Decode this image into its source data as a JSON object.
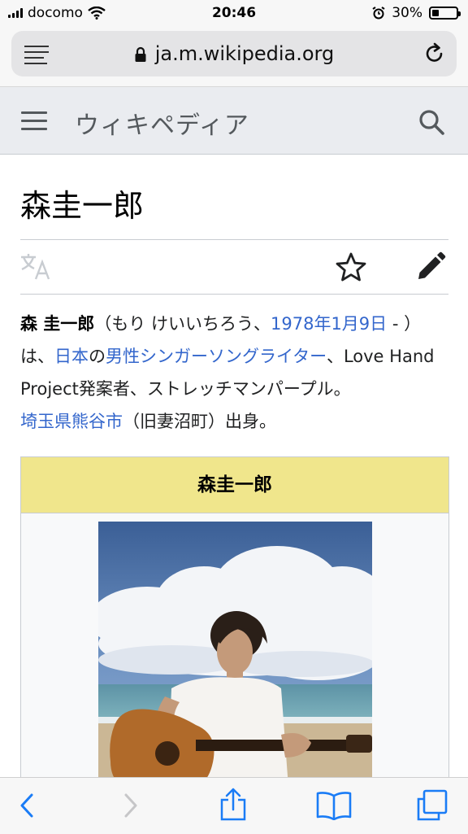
{
  "status": {
    "carrier": "docomo",
    "time": "20:46",
    "battery": "30%",
    "battery_level": 0.3
  },
  "browser": {
    "url": "ja.m.wikipedia.org"
  },
  "site": {
    "name": "ウィキペディア"
  },
  "article": {
    "title": "森圭一郎",
    "lede": {
      "name_bold": "森 圭一郎",
      "reading": "（もり けいいちろう、",
      "birthdate_link": "1978年1月9日",
      "dash": " - ）は、",
      "country_link": "日本",
      "particle": "の",
      "occupation_link": "男性シンガーソングライター",
      "rest": "、Love Hand Project発案者、ストレッチマンパープル。",
      "birthplace_link": "埼玉県熊谷市",
      "birthplace_rest": "（旧妻沼町）出身。"
    },
    "infobox": {
      "title": "森圭一郎"
    }
  },
  "colors": {
    "link": "#3366cc",
    "infobox_header": "#f0e68c",
    "header_bg": "#eaecf0",
    "ios_blue": "#1a7cf6"
  },
  "icons": {
    "reader": "reader-icon",
    "lock": "lock-icon",
    "reload": "reload-icon",
    "menu": "hamburger-menu-icon",
    "search": "search-icon",
    "language": "language-icon",
    "star": "star-icon",
    "edit": "edit-pencil-icon",
    "back": "back-chevron-icon",
    "forward": "forward-chevron-icon",
    "share": "share-icon",
    "bookmarks": "bookmarks-icon",
    "tabs": "tabs-icon"
  }
}
